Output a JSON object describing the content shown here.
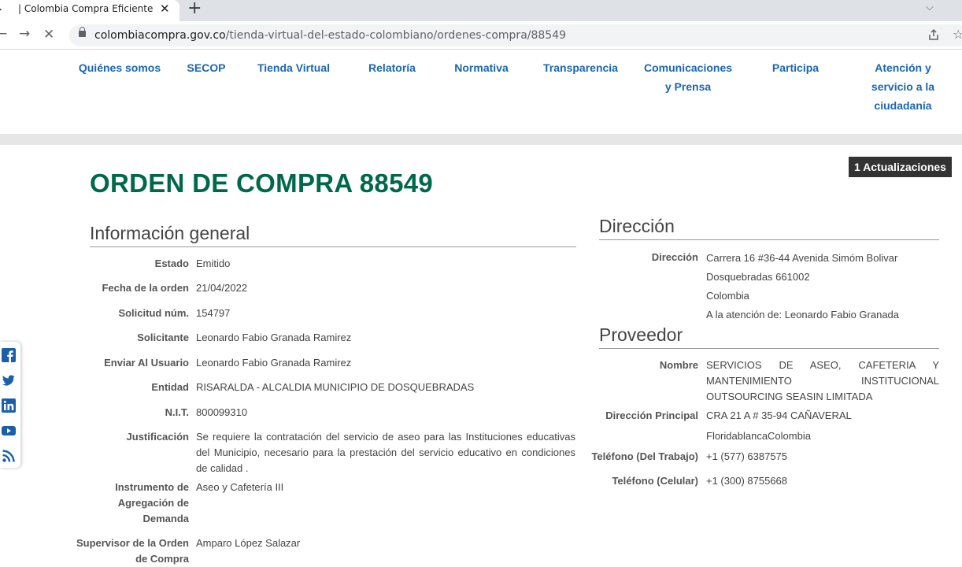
{
  "browser": {
    "tab_title": "| Colombia Compra Eficiente | Ag",
    "tab_close": "✕",
    "new_tab": "+",
    "url_host": "colombiacompra.gov.co",
    "url_path": "/tienda-virtual-del-estado-colombiano/ordenes-compra/88549"
  },
  "nav": {
    "items": [
      "Quiénes somos",
      "SECOP",
      "Tienda Virtual",
      "Relatoría",
      "Normativa",
      "Transparencia",
      [
        "Comunicaciones",
        "y Prensa"
      ],
      "Participa",
      [
        "Atención y",
        "servicio a la",
        "ciudadanía"
      ]
    ]
  },
  "page": {
    "title": "ORDEN DE COMPRA 88549",
    "updates_badge": "1 Actualizaciones"
  },
  "info_general": {
    "heading": "Información general",
    "rows": [
      {
        "label": "Estado",
        "value": "Emitido"
      },
      {
        "label": "Fecha de la orden",
        "value": "21/04/2022"
      },
      {
        "label": "Solicitud núm.",
        "value": "154797"
      },
      {
        "label": "Solicitante",
        "value": "Leonardo Fabio Granada Ramirez"
      },
      {
        "label": "Enviar Al Usuario",
        "value": "Leonardo Fabio Granada Ramirez"
      },
      {
        "label": "Entidad",
        "value": "RISARALDA - ALCALDIA MUNICIPIO DE DOSQUEBRADAS"
      },
      {
        "label": "N.I.T.",
        "value": "800099310"
      },
      {
        "label": "Justificación",
        "value": "Se requiere la contratación del servicio de aseo para las Instituciones educativas del Municipio, necesario para la prestación del servicio educativo en condiciones de calidad ."
      },
      {
        "label": "Instrumento de Agregación de Demanda",
        "value": "Aseo y Cafetería III"
      },
      {
        "label": "Supervisor de la Orden de Compra",
        "value": "Amparo López Salazar"
      }
    ]
  },
  "direccion": {
    "heading": "Dirección",
    "label": "Dirección",
    "lines": [
      "Carrera 16 #36-44 Avenida Simóm Bolivar",
      "Dosquebradas 661002",
      "Colombia",
      "A la atención de: Leonardo Fabio Granada"
    ]
  },
  "proveedor": {
    "heading": "Proveedor",
    "rows": [
      {
        "label": "Nombre",
        "value": "SERVICIOS DE ASEO, CAFETERIA Y MANTENIMIENTO INSTITUCIONAL OUTSOURCING SEASIN LIMITADA"
      },
      {
        "label": "Dirección Principal",
        "value": "CRA 21 A # 35-94 CAÑAVERAL"
      },
      {
        "label": "",
        "value": "FloridablancaColombia"
      },
      {
        "label": "Teléfono (Del Trabajo)",
        "value": "+1 (577) 6387575"
      },
      {
        "label": "Teléfono (Celular)",
        "value": "+1 (300) 8755668"
      }
    ]
  },
  "social": [
    "facebook-icon",
    "twitter-icon",
    "linkedin-icon",
    "youtube-icon",
    "rss-icon"
  ]
}
